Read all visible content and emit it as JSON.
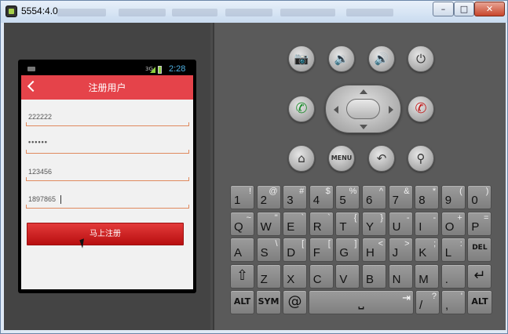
{
  "window": {
    "title": "5554:4.0",
    "buttons": {
      "minimize": "–",
      "maximize": "□",
      "close": "✕"
    }
  },
  "phone": {
    "status_time": "2:28",
    "status_network": "3G",
    "app": {
      "title": "注册用户",
      "fields": [
        {
          "value": "222222",
          "type": "text"
        },
        {
          "value": "••••••",
          "type": "password"
        },
        {
          "value": "123456",
          "type": "text"
        },
        {
          "value": "1897865",
          "type": "text"
        }
      ],
      "submit_label": "马上注册",
      "accent_color": "#e5434a"
    }
  },
  "hardware": {
    "camera": "📷",
    "vol_down": "🔉",
    "vol_up": "🔊",
    "power": "⏻",
    "call": "✆",
    "end_call": "✆",
    "home": "⌂",
    "menu": "MENU",
    "back": "↶",
    "search": "⚲"
  },
  "keyboard": {
    "row1": [
      {
        "main": "1",
        "alt": "!"
      },
      {
        "main": "2",
        "alt": "@"
      },
      {
        "main": "3",
        "alt": "#"
      },
      {
        "main": "4",
        "alt": "$"
      },
      {
        "main": "5",
        "alt": "%"
      },
      {
        "main": "6",
        "alt": "^"
      },
      {
        "main": "7",
        "alt": "&"
      },
      {
        "main": "8",
        "alt": "*"
      },
      {
        "main": "9",
        "alt": "("
      },
      {
        "main": "0",
        "alt": ")"
      }
    ],
    "row2": [
      {
        "main": "Q",
        "alt": "~"
      },
      {
        "main": "W",
        "alt": "\""
      },
      {
        "main": "E",
        "alt": "`"
      },
      {
        "main": "R",
        "alt": "`"
      },
      {
        "main": "T",
        "alt": "{"
      },
      {
        "main": "Y",
        "alt": "}"
      },
      {
        "main": "U",
        "alt": "-"
      },
      {
        "main": "I",
        "alt": "-"
      },
      {
        "main": "O",
        "alt": "+"
      },
      {
        "main": "P",
        "alt": "="
      }
    ],
    "row3": [
      {
        "main": "A",
        "alt": ""
      },
      {
        "main": "S",
        "alt": "\\"
      },
      {
        "main": "D",
        "alt": "["
      },
      {
        "main": "F",
        "alt": "["
      },
      {
        "main": "G",
        "alt": "]"
      },
      {
        "main": "H",
        "alt": "<"
      },
      {
        "main": "J",
        "alt": ">"
      },
      {
        "main": "K",
        "alt": ";"
      },
      {
        "main": "L",
        "alt": ":"
      },
      {
        "main": "DEL",
        "alt": ""
      }
    ],
    "row4": [
      {
        "main": "⇧",
        "alt": ""
      },
      {
        "main": "Z",
        "alt": ""
      },
      {
        "main": "X",
        "alt": ""
      },
      {
        "main": "C",
        "alt": ""
      },
      {
        "main": "V",
        "alt": ""
      },
      {
        "main": "B",
        "alt": ""
      },
      {
        "main": "N",
        "alt": ""
      },
      {
        "main": "M",
        "alt": ""
      },
      {
        "main": ".",
        "alt": ""
      },
      {
        "main": "↵",
        "alt": ""
      }
    ],
    "row5": {
      "alt_left": "ALT",
      "sym": "SYM",
      "at": "@",
      "space": "⎵",
      "tab": "⇥",
      "slash": "/",
      "slash_alt": "?",
      "comma": ",",
      "comma_alt": "'",
      "alt_right": "ALT"
    }
  }
}
